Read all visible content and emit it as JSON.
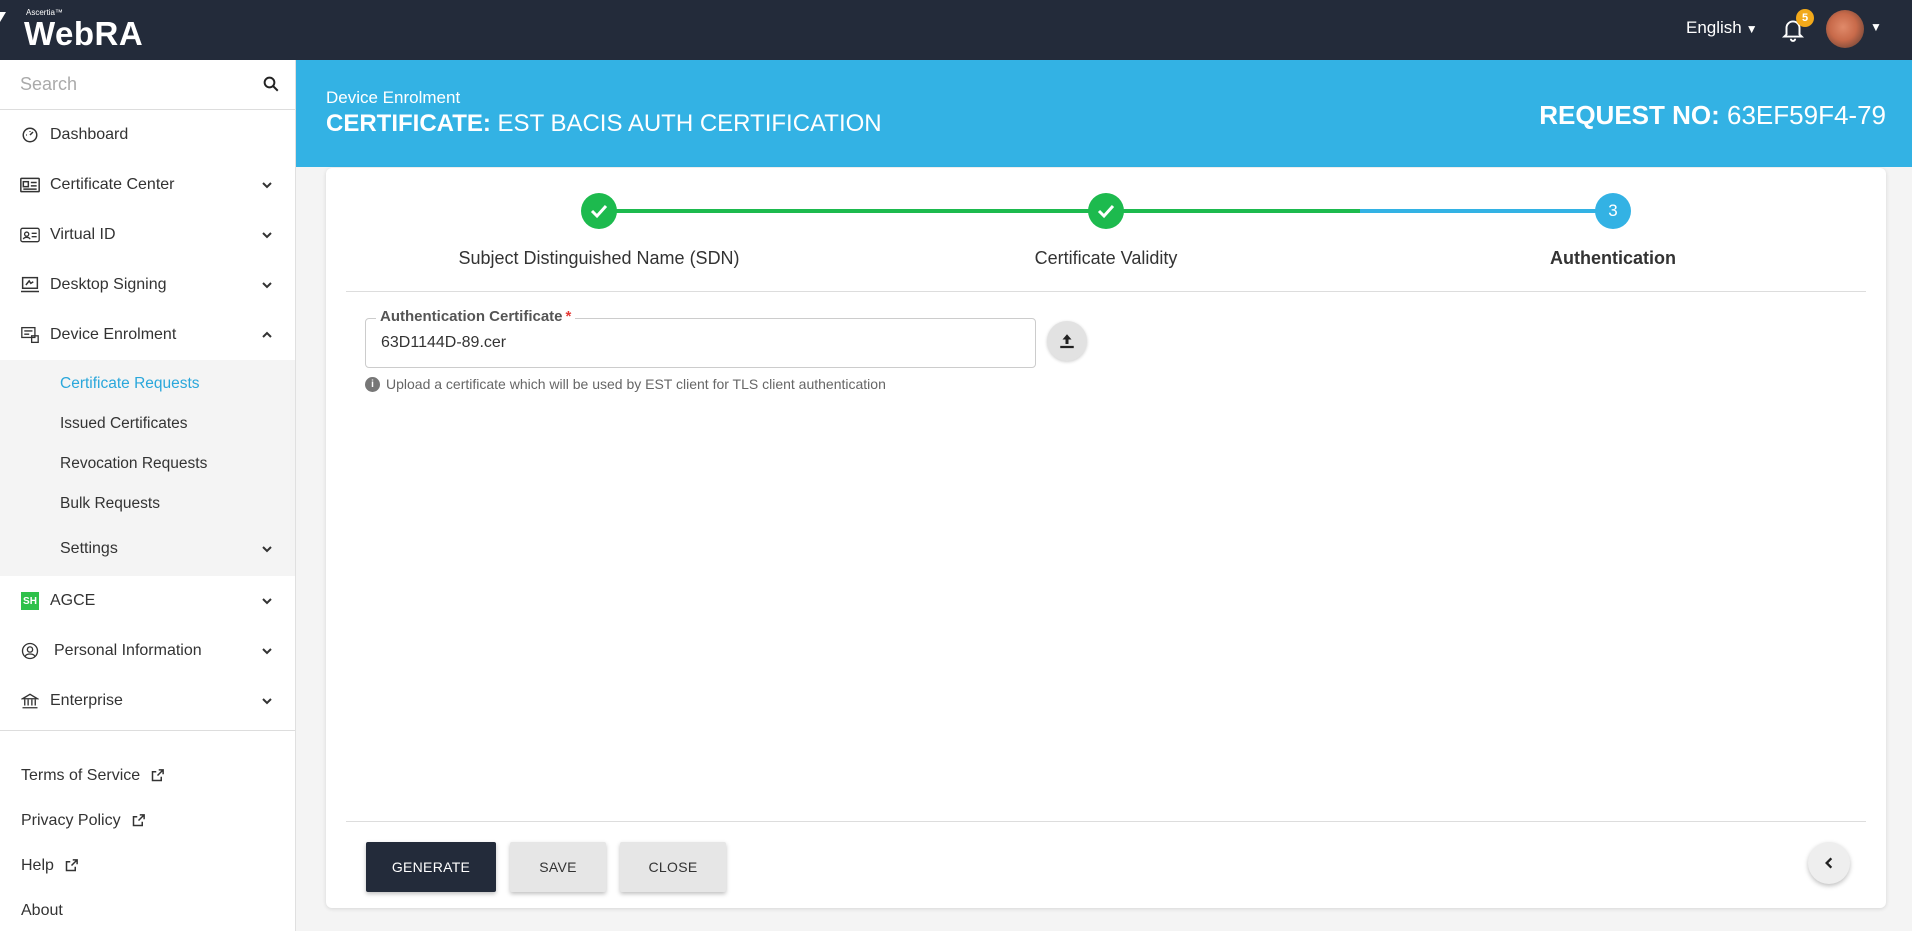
{
  "app": {
    "brand_small": "Ascertia™",
    "brand_name": "WebRA"
  },
  "topbar": {
    "language": "English",
    "notification_count": "5"
  },
  "sidebar": {
    "search_placeholder": "Search",
    "items": [
      {
        "label": "Dashboard",
        "icon": "dashboard-icon"
      },
      {
        "label": "Certificate Center",
        "icon": "certificate-icon"
      },
      {
        "label": "Virtual ID",
        "icon": "id-card-icon"
      },
      {
        "label": "Desktop Signing",
        "icon": "desktop-sign-icon"
      },
      {
        "label": "Device Enrolment",
        "icon": "device-icon"
      },
      {
        "label": "AGCE",
        "icon": "agce-icon",
        "badge_text": "SH"
      },
      {
        "label": "Personal Information",
        "icon": "user-icon"
      },
      {
        "label": "Enterprise",
        "icon": "bank-icon"
      }
    ],
    "device_enrolment_sub": [
      {
        "label": "Certificate Requests"
      },
      {
        "label": "Issued Certificates"
      },
      {
        "label": "Revocation Requests"
      },
      {
        "label": "Bulk Requests"
      },
      {
        "label": "Settings"
      }
    ],
    "footer": [
      {
        "label": "Terms of Service"
      },
      {
        "label": "Privacy Policy"
      },
      {
        "label": "Help"
      },
      {
        "label": "About"
      }
    ]
  },
  "header": {
    "subtitle": "Device Enrolment",
    "title_prefix": "CERTIFICATE:",
    "title": "EST BACIS AUTH CERTIFICATION",
    "request_prefix": "REQUEST NO:",
    "request_no": "63EF59F4-79"
  },
  "stepper": {
    "steps": [
      {
        "label": "Subject Distinguished Name (SDN)",
        "state": "done"
      },
      {
        "label": "Certificate Validity",
        "state": "done"
      },
      {
        "label": "Authentication",
        "state": "current",
        "number": "3"
      }
    ]
  },
  "form": {
    "auth_cert_label": "Authentication Certificate",
    "required_mark": "*",
    "auth_cert_value": "63D1144D-89.cer",
    "hint_icon_text": "i",
    "hint": "Upload a certificate which will be used by EST client for TLS client authentication"
  },
  "actions": {
    "generate": "GENERATE",
    "save": "SAVE",
    "close": "CLOSE"
  },
  "colors": {
    "topbar": "#232b3a",
    "accent": "#33b2e4",
    "success": "#1dba4e",
    "active_link": "#2aa7db"
  }
}
